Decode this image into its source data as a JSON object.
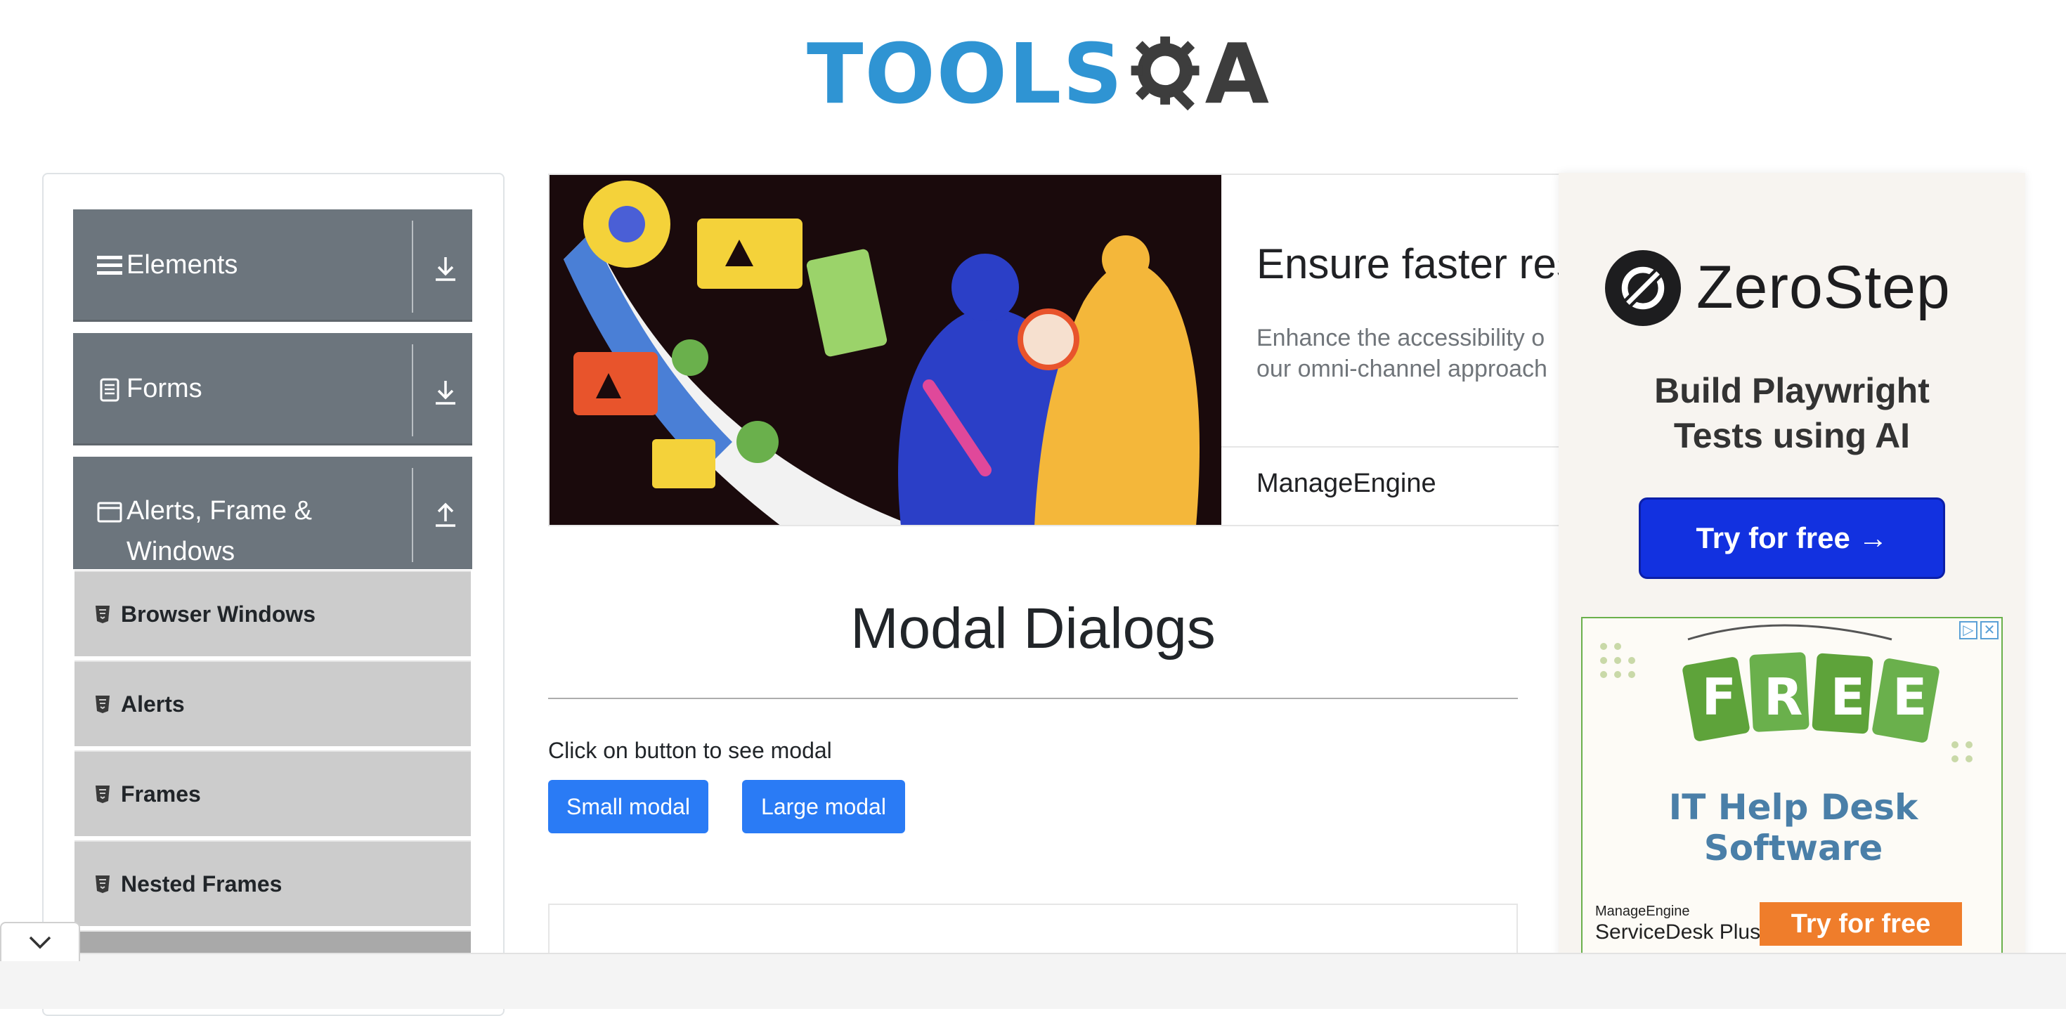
{
  "header": {
    "logo_text_primary": "TOOLS",
    "logo_text_secondary": "A"
  },
  "sidebar": {
    "groups": [
      {
        "label": "Elements",
        "icon": "hamburger-icon",
        "arrow": "download-arrow-icon",
        "expanded": false
      },
      {
        "label": "Forms",
        "icon": "document-icon",
        "arrow": "download-arrow-icon",
        "expanded": false
      },
      {
        "label_line1": "Alerts, Frame &",
        "label_line2": "Windows",
        "icon": "window-icon",
        "arrow": "upload-arrow-icon",
        "expanded": true
      }
    ],
    "items": [
      {
        "label": "Browser Windows",
        "icon": "html5-icon"
      },
      {
        "label": "Alerts",
        "icon": "html5-icon"
      },
      {
        "label": "Frames",
        "icon": "html5-icon"
      },
      {
        "label": "Nested Frames",
        "icon": "html5-icon"
      }
    ]
  },
  "banner": {
    "title": "Ensure faster res",
    "description_line1": "Enhance the accessibility o",
    "description_line2": "our omni-channel approach",
    "brand": "ManageEngine"
  },
  "main": {
    "page_title": "Modal Dialogs",
    "instruction": "Click on button to see modal",
    "small_modal_label": "Small modal",
    "large_modal_label": "Large modal"
  },
  "ads": {
    "zerostep": {
      "name": "ZeroStep",
      "tagline_line1": "Build Playwright",
      "tagline_line2": "Tests using AI",
      "cta": "Try for free →"
    },
    "servicedesk": {
      "tags": [
        "F",
        "R",
        "E",
        "E"
      ],
      "title": "IT Help Desk Software",
      "brand_line1": "ManageEngine",
      "brand_line2": "ServiceDesk Plus",
      "cta": "Try for free"
    }
  },
  "colors": {
    "sidebar_header": "#6c757d",
    "sidebar_item": "#cccccc",
    "primary_button": "#2a7bf5",
    "logo_blue": "#2f94d3",
    "zerostep_button": "#1231e0",
    "sdp_button": "#ef7d2b"
  }
}
